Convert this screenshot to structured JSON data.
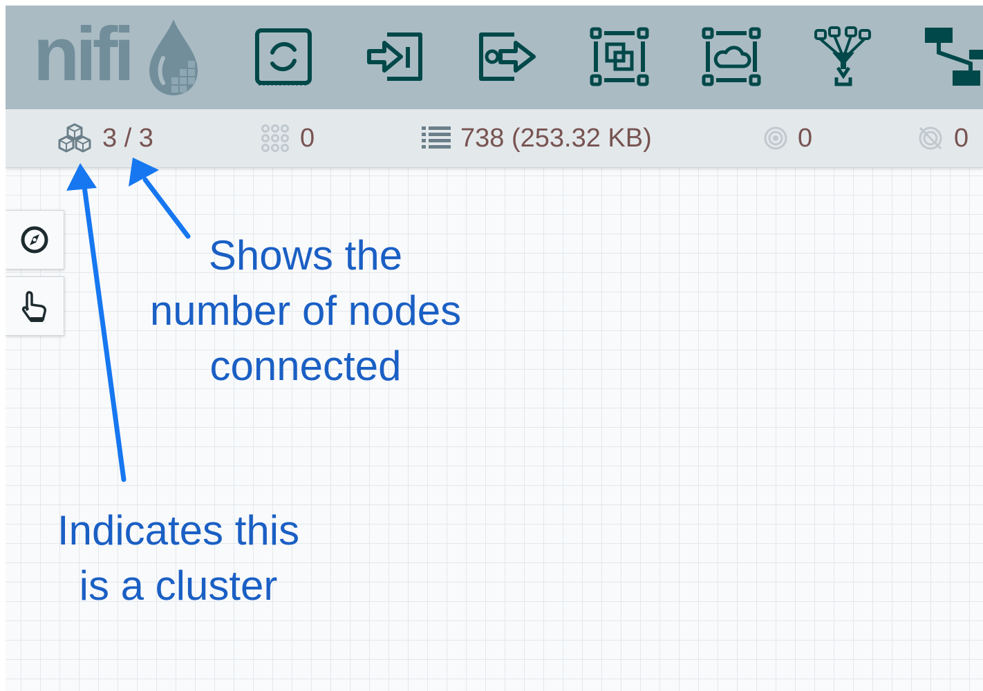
{
  "app": {
    "logo_text": "nifi"
  },
  "toolbar": {
    "items": [
      {
        "name": "processor",
        "icon": "processor-icon"
      },
      {
        "name": "input-port",
        "icon": "input-port-icon"
      },
      {
        "name": "output-port",
        "icon": "output-port-icon"
      },
      {
        "name": "process-group",
        "icon": "process-group-icon"
      },
      {
        "name": "remote-process-group",
        "icon": "remote-process-group-icon"
      },
      {
        "name": "funnel",
        "icon": "funnel-icon"
      },
      {
        "name": "template",
        "icon": "template-icon"
      }
    ]
  },
  "status": {
    "cluster_nodes": "3 / 3",
    "active_threads": "0",
    "queued": "738 (253.32 KB)",
    "transmitting": "0",
    "not_transmitting": "0"
  },
  "side_controls": [
    {
      "name": "navigate",
      "icon": "compass-icon"
    },
    {
      "name": "operate",
      "icon": "hand-pointer-icon"
    }
  ],
  "annotations": {
    "nodes_connected": [
      "Shows the",
      "number of nodes",
      "connected"
    ],
    "cluster": [
      "Indicates this",
      "is a cluster"
    ]
  },
  "colors": {
    "header_bg": "#aabbc3",
    "icon_dark": "#004849",
    "logo": "#728e9b",
    "status_text": "#775351",
    "annotation": "#1a5fc4",
    "arrow": "#1677f0"
  }
}
